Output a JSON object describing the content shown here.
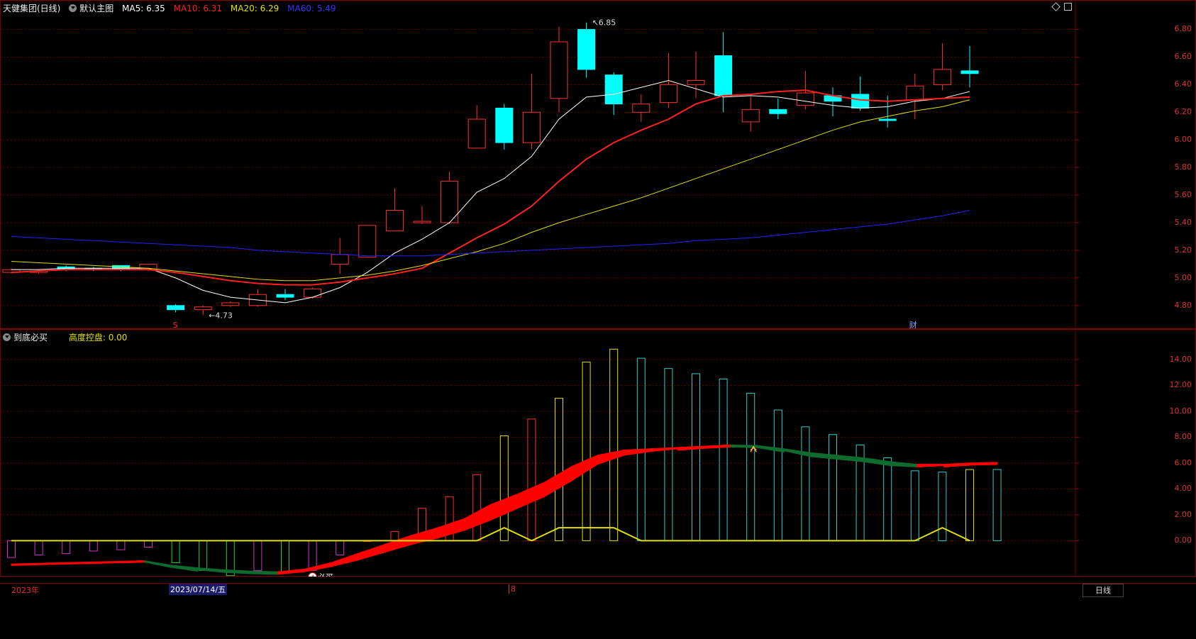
{
  "top_header": {
    "stock_title": "天健集团(日线)",
    "main_chart_menu": "默认主图",
    "ma5": "MA5: 6.35",
    "ma10": "MA10: 6.31",
    "ma20": "MA20: 6.29",
    "ma60": "MA60: 5.49"
  },
  "bottom_header": {
    "indicator_menu": "到底必买",
    "control_label": "高度控盘: 0.00"
  },
  "colors": {
    "up": "#ff3030",
    "down": "#00ffff",
    "ma5": "#ffffff",
    "ma10": "#ff2020",
    "ma20": "#e0e000",
    "ma60": "#2222ff",
    "grid": "#6a0000",
    "bull_band": "#ff0000",
    "bear_band": "#0f6b2e"
  },
  "chart_data": [
    {
      "type": "candlestick",
      "title": "天健集团(日线)",
      "ylim": [
        4.65,
        6.9
      ],
      "yticks": [
        "6.80",
        "6.60",
        "6.40",
        "6.20",
        "6.00",
        "5.80",
        "5.60",
        "5.40",
        "5.20",
        "5.00",
        "4.80"
      ],
      "annotations": {
        "high_label": "6.85",
        "low_label": "4.73",
        "marker_s": "S",
        "marker_cai": "财"
      },
      "candles": [
        {
          "o": 5.04,
          "c": 5.06,
          "h": 5.07,
          "l": 5.03
        },
        {
          "o": 5.04,
          "c": 5.05,
          "h": 5.06,
          "l": 5.03
        },
        {
          "o": 5.08,
          "c": 5.06,
          "h": 5.09,
          "l": 5.05
        },
        {
          "o": 5.07,
          "c": 5.06,
          "h": 5.08,
          "l": 5.05
        },
        {
          "o": 5.09,
          "c": 5.06,
          "h": 5.09,
          "l": 5.05
        },
        {
          "o": 5.06,
          "c": 5.1,
          "h": 5.1,
          "l": 5.05
        },
        {
          "o": 4.8,
          "c": 4.77,
          "h": 4.81,
          "l": 4.75
        },
        {
          "o": 4.77,
          "c": 4.79,
          "h": 4.8,
          "l": 4.73
        },
        {
          "o": 4.8,
          "c": 4.82,
          "h": 4.83,
          "l": 4.79
        },
        {
          "o": 4.8,
          "c": 4.88,
          "h": 4.92,
          "l": 4.79
        },
        {
          "o": 4.88,
          "c": 4.86,
          "h": 4.92,
          "l": 4.84
        },
        {
          "o": 4.86,
          "c": 4.92,
          "h": 4.93,
          "l": 4.85
        },
        {
          "o": 5.1,
          "c": 5.17,
          "h": 5.29,
          "l": 5.03
        },
        {
          "o": 5.15,
          "c": 5.38,
          "h": 5.38,
          "l": 5.15
        },
        {
          "o": 5.34,
          "c": 5.49,
          "h": 5.65,
          "l": 5.34
        },
        {
          "o": 5.4,
          "c": 5.41,
          "h": 5.52,
          "l": 5.39
        },
        {
          "o": 5.4,
          "c": 5.7,
          "h": 5.77,
          "l": 5.39
        },
        {
          "o": 5.94,
          "c": 6.15,
          "h": 6.25,
          "l": 5.94
        },
        {
          "o": 6.23,
          "c": 5.98,
          "h": 6.26,
          "l": 5.93
        },
        {
          "o": 5.98,
          "c": 6.2,
          "h": 6.48,
          "l": 5.93
        },
        {
          "o": 6.3,
          "c": 6.71,
          "h": 6.82,
          "l": 6.2
        },
        {
          "o": 6.8,
          "c": 6.51,
          "h": 6.85,
          "l": 6.45
        },
        {
          "o": 6.47,
          "c": 6.26,
          "h": 6.49,
          "l": 6.18
        },
        {
          "o": 6.2,
          "c": 6.26,
          "h": 6.33,
          "l": 6.13
        },
        {
          "o": 6.27,
          "c": 6.4,
          "h": 6.63,
          "l": 6.23
        },
        {
          "o": 6.4,
          "c": 6.43,
          "h": 6.64,
          "l": 6.3
        },
        {
          "o": 6.61,
          "c": 6.32,
          "h": 6.78,
          "l": 6.2
        },
        {
          "o": 6.13,
          "c": 6.22,
          "h": 6.31,
          "l": 6.06
        },
        {
          "o": 6.22,
          "c": 6.19,
          "h": 6.3,
          "l": 6.15
        },
        {
          "o": 6.25,
          "c": 6.34,
          "h": 6.5,
          "l": 6.22
        },
        {
          "o": 6.32,
          "c": 6.28,
          "h": 6.38,
          "l": 6.17
        },
        {
          "o": 6.33,
          "c": 6.23,
          "h": 6.46,
          "l": 6.21
        },
        {
          "o": 6.15,
          "c": 6.14,
          "h": 6.32,
          "l": 6.09
        },
        {
          "o": 6.29,
          "c": 6.39,
          "h": 6.48,
          "l": 6.15
        },
        {
          "o": 6.4,
          "c": 6.51,
          "h": 6.7,
          "l": 6.36
        },
        {
          "o": 6.5,
          "c": 6.48,
          "h": 6.68,
          "l": 6.38
        }
      ],
      "series": [
        {
          "name": "MA5",
          "values": [
            5.06,
            5.06,
            5.07,
            5.07,
            5.07,
            5.07,
            5.0,
            4.91,
            4.86,
            4.84,
            4.82,
            4.86,
            4.93,
            5.04,
            5.18,
            5.28,
            5.4,
            5.62,
            5.72,
            5.88,
            6.15,
            6.31,
            6.33,
            6.38,
            6.43,
            6.37,
            6.31,
            6.32,
            6.31,
            6.28,
            6.25,
            6.23,
            6.24,
            6.28,
            6.3,
            6.35
          ]
        },
        {
          "name": "MA10",
          "values": [
            5.04,
            5.05,
            5.06,
            5.06,
            5.06,
            5.06,
            5.04,
            5.01,
            4.98,
            4.96,
            4.95,
            4.95,
            4.97,
            5.0,
            5.03,
            5.07,
            5.18,
            5.29,
            5.39,
            5.52,
            5.7,
            5.86,
            5.98,
            6.07,
            6.15,
            6.26,
            6.32,
            6.33,
            6.35,
            6.36,
            6.32,
            6.29,
            6.28,
            6.29,
            6.3,
            6.31
          ]
        },
        {
          "name": "MA20",
          "values": [
            5.12,
            5.11,
            5.1,
            5.09,
            5.08,
            5.07,
            5.05,
            5.03,
            5.01,
            4.99,
            4.98,
            4.98,
            5.0,
            5.02,
            5.05,
            5.09,
            5.14,
            5.19,
            5.25,
            5.33,
            5.4,
            5.46,
            5.52,
            5.58,
            5.65,
            5.72,
            5.79,
            5.86,
            5.93,
            6.0,
            6.07,
            6.13,
            6.17,
            6.21,
            6.24,
            6.29
          ]
        },
        {
          "name": "MA60",
          "values": [
            5.3,
            5.29,
            5.28,
            5.27,
            5.26,
            5.25,
            5.24,
            5.23,
            5.22,
            5.2,
            5.19,
            5.18,
            5.17,
            5.16,
            5.16,
            5.16,
            5.17,
            5.18,
            5.19,
            5.2,
            5.21,
            5.22,
            5.23,
            5.24,
            5.25,
            5.27,
            5.28,
            5.29,
            5.31,
            5.33,
            5.35,
            5.37,
            5.39,
            5.42,
            5.45,
            5.49
          ]
        }
      ]
    },
    {
      "type": "bar",
      "title": "到底必买",
      "ylim": [
        -2.5,
        15.2
      ],
      "yticks": [
        "14.00",
        "12.00",
        "10.00",
        "8.00",
        "6.00",
        "4.00",
        "2.00",
        "0.00"
      ],
      "annotations": {
        "buy_label": "必买",
        "buy_marker": "+"
      },
      "bars": [
        {
          "v": -1.3,
          "color": "#cc33cc"
        },
        {
          "v": -1.1,
          "color": "#cc33cc"
        },
        {
          "v": -1.0,
          "color": "#cc33cc"
        },
        {
          "v": -0.8,
          "color": "#cc33cc"
        },
        {
          "v": -0.7,
          "color": "#cc33cc"
        },
        {
          "v": -0.5,
          "color": "#cc33cc"
        },
        {
          "v": -1.7,
          "color": "#33cc33"
        },
        {
          "v": -2.3,
          "color": "#33cc33"
        },
        {
          "v": -2.7,
          "color": "#33cc33"
        },
        {
          "v": -2.3,
          "color": "#cc33cc"
        },
        {
          "v": -2.5,
          "color": "#33cc33"
        },
        {
          "v": -2.3,
          "color": "#cc33cc"
        },
        {
          "v": -1.1,
          "color": "#cc33cc"
        },
        {
          "v": 0.0,
          "color": "#ff3030"
        },
        {
          "v": 0.7,
          "color": "#ff3030"
        },
        {
          "v": 2.5,
          "color": "#ff3030"
        },
        {
          "v": 3.4,
          "color": "#ff3030"
        },
        {
          "v": 5.1,
          "color": "#ff3030"
        },
        {
          "v": 8.1,
          "color": "#e0e000"
        },
        {
          "v": 9.4,
          "color": "#ff3030"
        },
        {
          "v": 11.0,
          "color": "#e0e000"
        },
        {
          "v": 13.8,
          "color": "#e0e000"
        },
        {
          "v": 14.8,
          "color": "#e0e000"
        },
        {
          "v": 14.1,
          "color": "#33cccc"
        },
        {
          "v": 13.3,
          "color": "#33cccc"
        },
        {
          "v": 12.9,
          "color": "#33cccc"
        },
        {
          "v": 12.5,
          "color": "#33cccc"
        },
        {
          "v": 11.4,
          "color": "#33cccc"
        },
        {
          "v": 10.1,
          "color": "#33cccc"
        },
        {
          "v": 8.8,
          "color": "#33cccc"
        },
        {
          "v": 8.2,
          "color": "#33cccc"
        },
        {
          "v": 7.4,
          "color": "#33cccc"
        },
        {
          "v": 6.4,
          "color": "#33cccc"
        },
        {
          "v": 5.4,
          "color": "#33cccc"
        },
        {
          "v": 5.3,
          "color": "#33cccc"
        },
        {
          "v": 5.5,
          "color": "#e0e000"
        },
        {
          "v": 5.5,
          "color": "#33cccc"
        }
      ],
      "band_upper": [
        -1.8,
        -1.75,
        -1.7,
        -1.65,
        -1.6,
        -1.55,
        -1.9,
        -2.1,
        -2.25,
        -2.35,
        -2.4,
        -2.2,
        -1.7,
        -1.0,
        -0.3,
        0.4,
        1.0,
        1.7,
        2.8,
        3.6,
        4.5,
        5.7,
        6.6,
        7.0,
        7.1,
        7.2,
        7.3,
        7.4,
        7.35,
        7.1,
        6.8,
        6.6,
        6.4,
        6.1,
        5.9,
        5.9,
        6.0,
        6.05
      ],
      "band_lower": [
        -1.8,
        -1.75,
        -1.7,
        -1.65,
        -1.6,
        -1.55,
        -1.95,
        -2.25,
        -2.45,
        -2.55,
        -2.6,
        -2.4,
        -2.0,
        -1.5,
        -0.9,
        -0.3,
        0.2,
        0.8,
        1.6,
        2.5,
        3.4,
        4.6,
        5.9,
        6.6,
        6.9,
        7.1,
        7.25,
        7.35,
        7.3,
        6.95,
        6.5,
        6.3,
        6.1,
        5.8,
        5.7,
        5.8,
        5.95,
        6.0
      ],
      "height_line": [
        0,
        0,
        0,
        0,
        0,
        0,
        0,
        0,
        0,
        0,
        0,
        0,
        0,
        0,
        0,
        0,
        0,
        0,
        1.0,
        0,
        1.0,
        1.0,
        1.0,
        0,
        0,
        0,
        0,
        0,
        0,
        0,
        0,
        0,
        0,
        0,
        1.0,
        0
      ]
    }
  ],
  "x_axis": {
    "start_label": "2023年",
    "date_label": "2023/07/14/五",
    "month_marker": "8",
    "period_tab": "日线"
  }
}
